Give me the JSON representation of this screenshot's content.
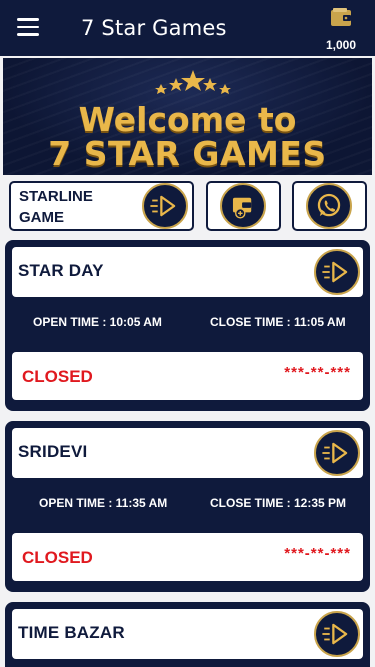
{
  "header": {
    "title": "7 Star Games",
    "wallet_balance": "1,000",
    "menu_icon": "hamburger-icon",
    "wallet_icon": "wallet-icon"
  },
  "banner": {
    "line1": "Welcome to",
    "line2": "7 STAR GAMES"
  },
  "quick_actions": {
    "starline_label": "STARLINE GAME",
    "starline_icon": "play-icon",
    "wallet_icon": "wallet-add-icon",
    "whatsapp_icon": "whatsapp-icon"
  },
  "markets": [
    {
      "name": "STAR DAY",
      "open_time": "OPEN TIME : 10:05 AM",
      "close_time": "CLOSE TIME : 11:05 AM",
      "status": "CLOSED",
      "result": "***-**-***"
    },
    {
      "name": "SRIDEVI",
      "open_time": "OPEN TIME : 11:35 AM",
      "close_time": "CLOSE TIME : 12:35 PM",
      "status": "CLOSED",
      "result": "***-**-***"
    },
    {
      "name": "TIME BAZAR"
    }
  ],
  "colors": {
    "navy": "#0f1a3c",
    "gold": "#c9a44c",
    "closed_red": "#e0191f"
  }
}
